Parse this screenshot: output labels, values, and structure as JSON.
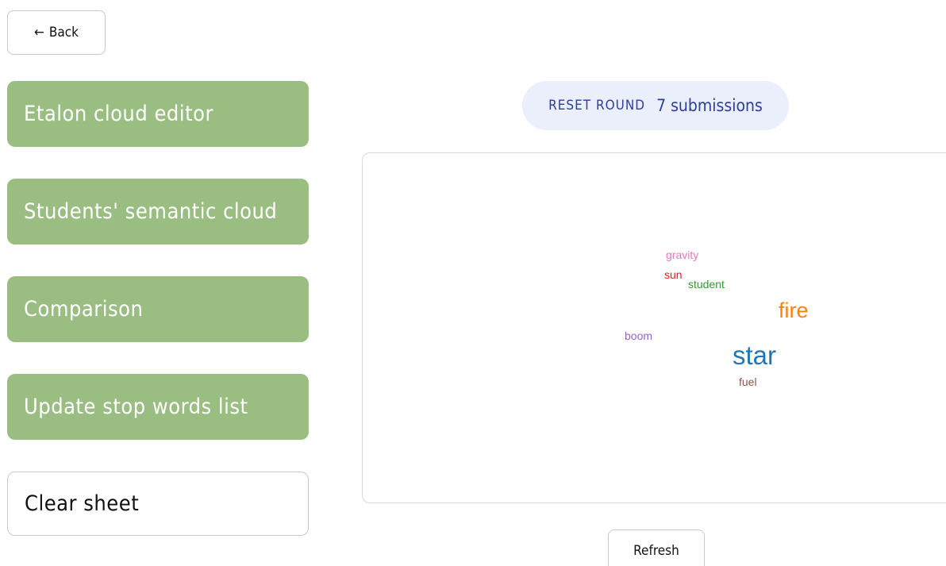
{
  "back": {
    "arrow": "←",
    "label": "Back"
  },
  "nav": {
    "etalon_label": "Etalon cloud editor",
    "students_label": "Students' semantic cloud",
    "comparison_label": "Comparison",
    "stopwords_label": "Update stop words list",
    "clear_label": "Clear sheet"
  },
  "round": {
    "reset_label": "RESET ROUND",
    "submissions_text": "7 submissions"
  },
  "cloud": {
    "words": [
      {
        "text": "gravity",
        "color": "#e377c2"
      },
      {
        "text": "sun",
        "color": "#d62728"
      },
      {
        "text": "student",
        "color": "#2ca02c"
      },
      {
        "text": "fire",
        "color": "#ff7f0e"
      },
      {
        "text": "boom",
        "color": "#9467bd"
      },
      {
        "text": "star",
        "color": "#1f77b4"
      },
      {
        "text": "fuel",
        "color": "#8c564b"
      }
    ]
  },
  "refresh_label": "Refresh",
  "colors": {
    "nav_green": "#9abd82",
    "pill_bg": "#ebeefb",
    "pill_text": "#2d3f96"
  }
}
